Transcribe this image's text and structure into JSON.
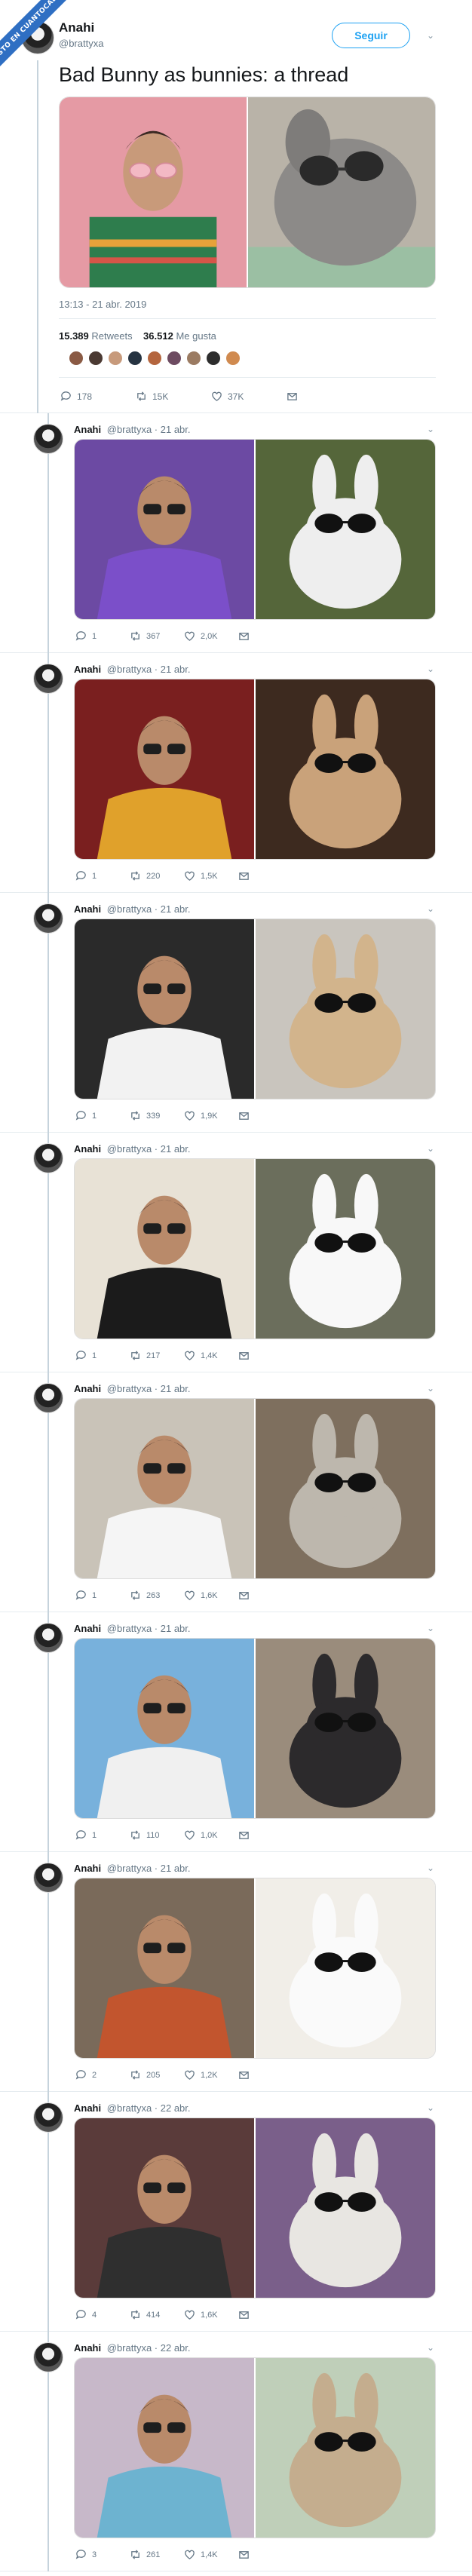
{
  "watermark": "VISTO EN CUANTOCABRON",
  "tweet": {
    "name": "Anahi",
    "handle": "@brattyxa",
    "follow_label": "Seguir",
    "text": "Bad Bunny as bunnies: a thread",
    "timestamp": "13:13 - 21 abr. 2019",
    "retweets_count": "15.389",
    "retweets_label": "Retweets",
    "likes_count": "36.512",
    "likes_label": "Me gusta",
    "actions": {
      "replies": "178",
      "retweets": "15K",
      "likes": "37K"
    }
  },
  "replies": [
    {
      "name": "Anahi",
      "meta": "@brattyxa · 21 abr.",
      "replies": "1",
      "retweets": "367",
      "likes": "2,0K"
    },
    {
      "name": "Anahi",
      "meta": "@brattyxa · 21 abr.",
      "replies": "1",
      "retweets": "220",
      "likes": "1,5K"
    },
    {
      "name": "Anahi",
      "meta": "@brattyxa · 21 abr.",
      "replies": "1",
      "retweets": "339",
      "likes": "1,9K"
    },
    {
      "name": "Anahi",
      "meta": "@brattyxa · 21 abr.",
      "replies": "1",
      "retweets": "217",
      "likes": "1,4K"
    },
    {
      "name": "Anahi",
      "meta": "@brattyxa · 21 abr.",
      "replies": "1",
      "retweets": "263",
      "likes": "1,6K"
    },
    {
      "name": "Anahi",
      "meta": "@brattyxa · 21 abr.",
      "replies": "1",
      "retweets": "110",
      "likes": "1,0K"
    },
    {
      "name": "Anahi",
      "meta": "@brattyxa · 21 abr.",
      "replies": "2",
      "retweets": "205",
      "likes": "1,2K"
    },
    {
      "name": "Anahi",
      "meta": "@brattyxa · 22 abr.",
      "replies": "4",
      "retweets": "414",
      "likes": "1,6K"
    },
    {
      "name": "Anahi",
      "meta": "@brattyxa · 22 abr.",
      "replies": "3",
      "retweets": "261",
      "likes": "1,4K"
    }
  ],
  "colors": {
    "accent": "#1da1f2",
    "thread_line": "#c6d3dc",
    "muted_text": "#657786",
    "watermark": "#2f6fc3"
  },
  "icons": [
    "reply-icon",
    "retweet-icon",
    "like-icon",
    "dm-icon",
    "chevron-down-icon"
  ]
}
